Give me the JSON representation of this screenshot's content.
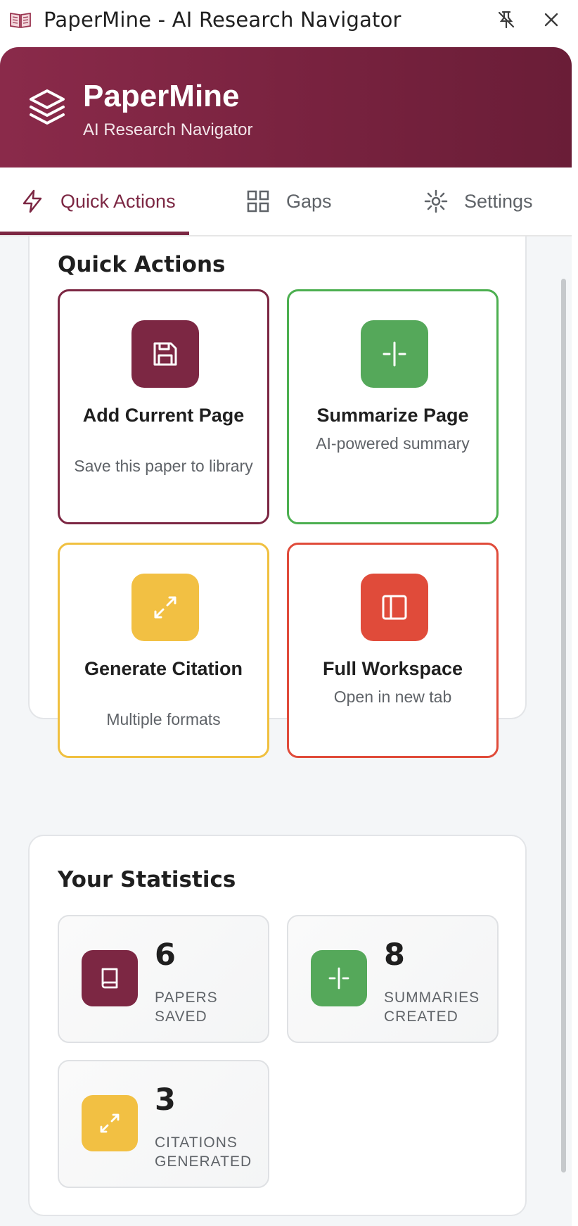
{
  "window": {
    "title": "PaperMine - AI Research Navigator",
    "app_icon": "open-book-icon",
    "buttons": [
      "unpin-icon",
      "close-icon"
    ]
  },
  "header": {
    "name": "PaperMine",
    "subtitle": "AI Research Navigator",
    "logo_icon": "layers-icon",
    "gradient_colors": [
      "#8a2a4a",
      "#6a1d37"
    ]
  },
  "tabs": [
    {
      "label": "Quick Actions",
      "icon": "lightning-icon",
      "active": true
    },
    {
      "label": "Gaps",
      "icon": "grid-icon",
      "active": false
    },
    {
      "label": "Settings",
      "icon": "sun-gear-icon",
      "active": false
    }
  ],
  "quick_actions": {
    "title": "Quick Actions",
    "items": [
      {
        "title": "Add Current Page",
        "description": "Save this paper to library",
        "icon": "save-icon",
        "color": "#7c2743"
      },
      {
        "title": "Summarize Page",
        "description": "AI-powered summary",
        "icon": "split-icon",
        "color": "#55a85a"
      },
      {
        "title": "Generate Citation",
        "description": "Multiple formats",
        "icon": "expand-arrows-icon",
        "color": "#f2c043"
      },
      {
        "title": "Full Workspace",
        "description": "Open in new tab",
        "icon": "panel-icon",
        "color": "#e04b3a"
      }
    ]
  },
  "statistics": {
    "title": "Your Statistics",
    "items": [
      {
        "value": "6",
        "label": "PAPERS SAVED",
        "icon": "book-icon",
        "color": "#7c2743"
      },
      {
        "value": "8",
        "label": "SUMMARIES CREATED",
        "icon": "split-icon",
        "color": "#55a85a"
      },
      {
        "value": "3",
        "label": "CITATIONS GENERATED",
        "icon": "expand-arrows-icon",
        "color": "#f2c043"
      }
    ]
  }
}
